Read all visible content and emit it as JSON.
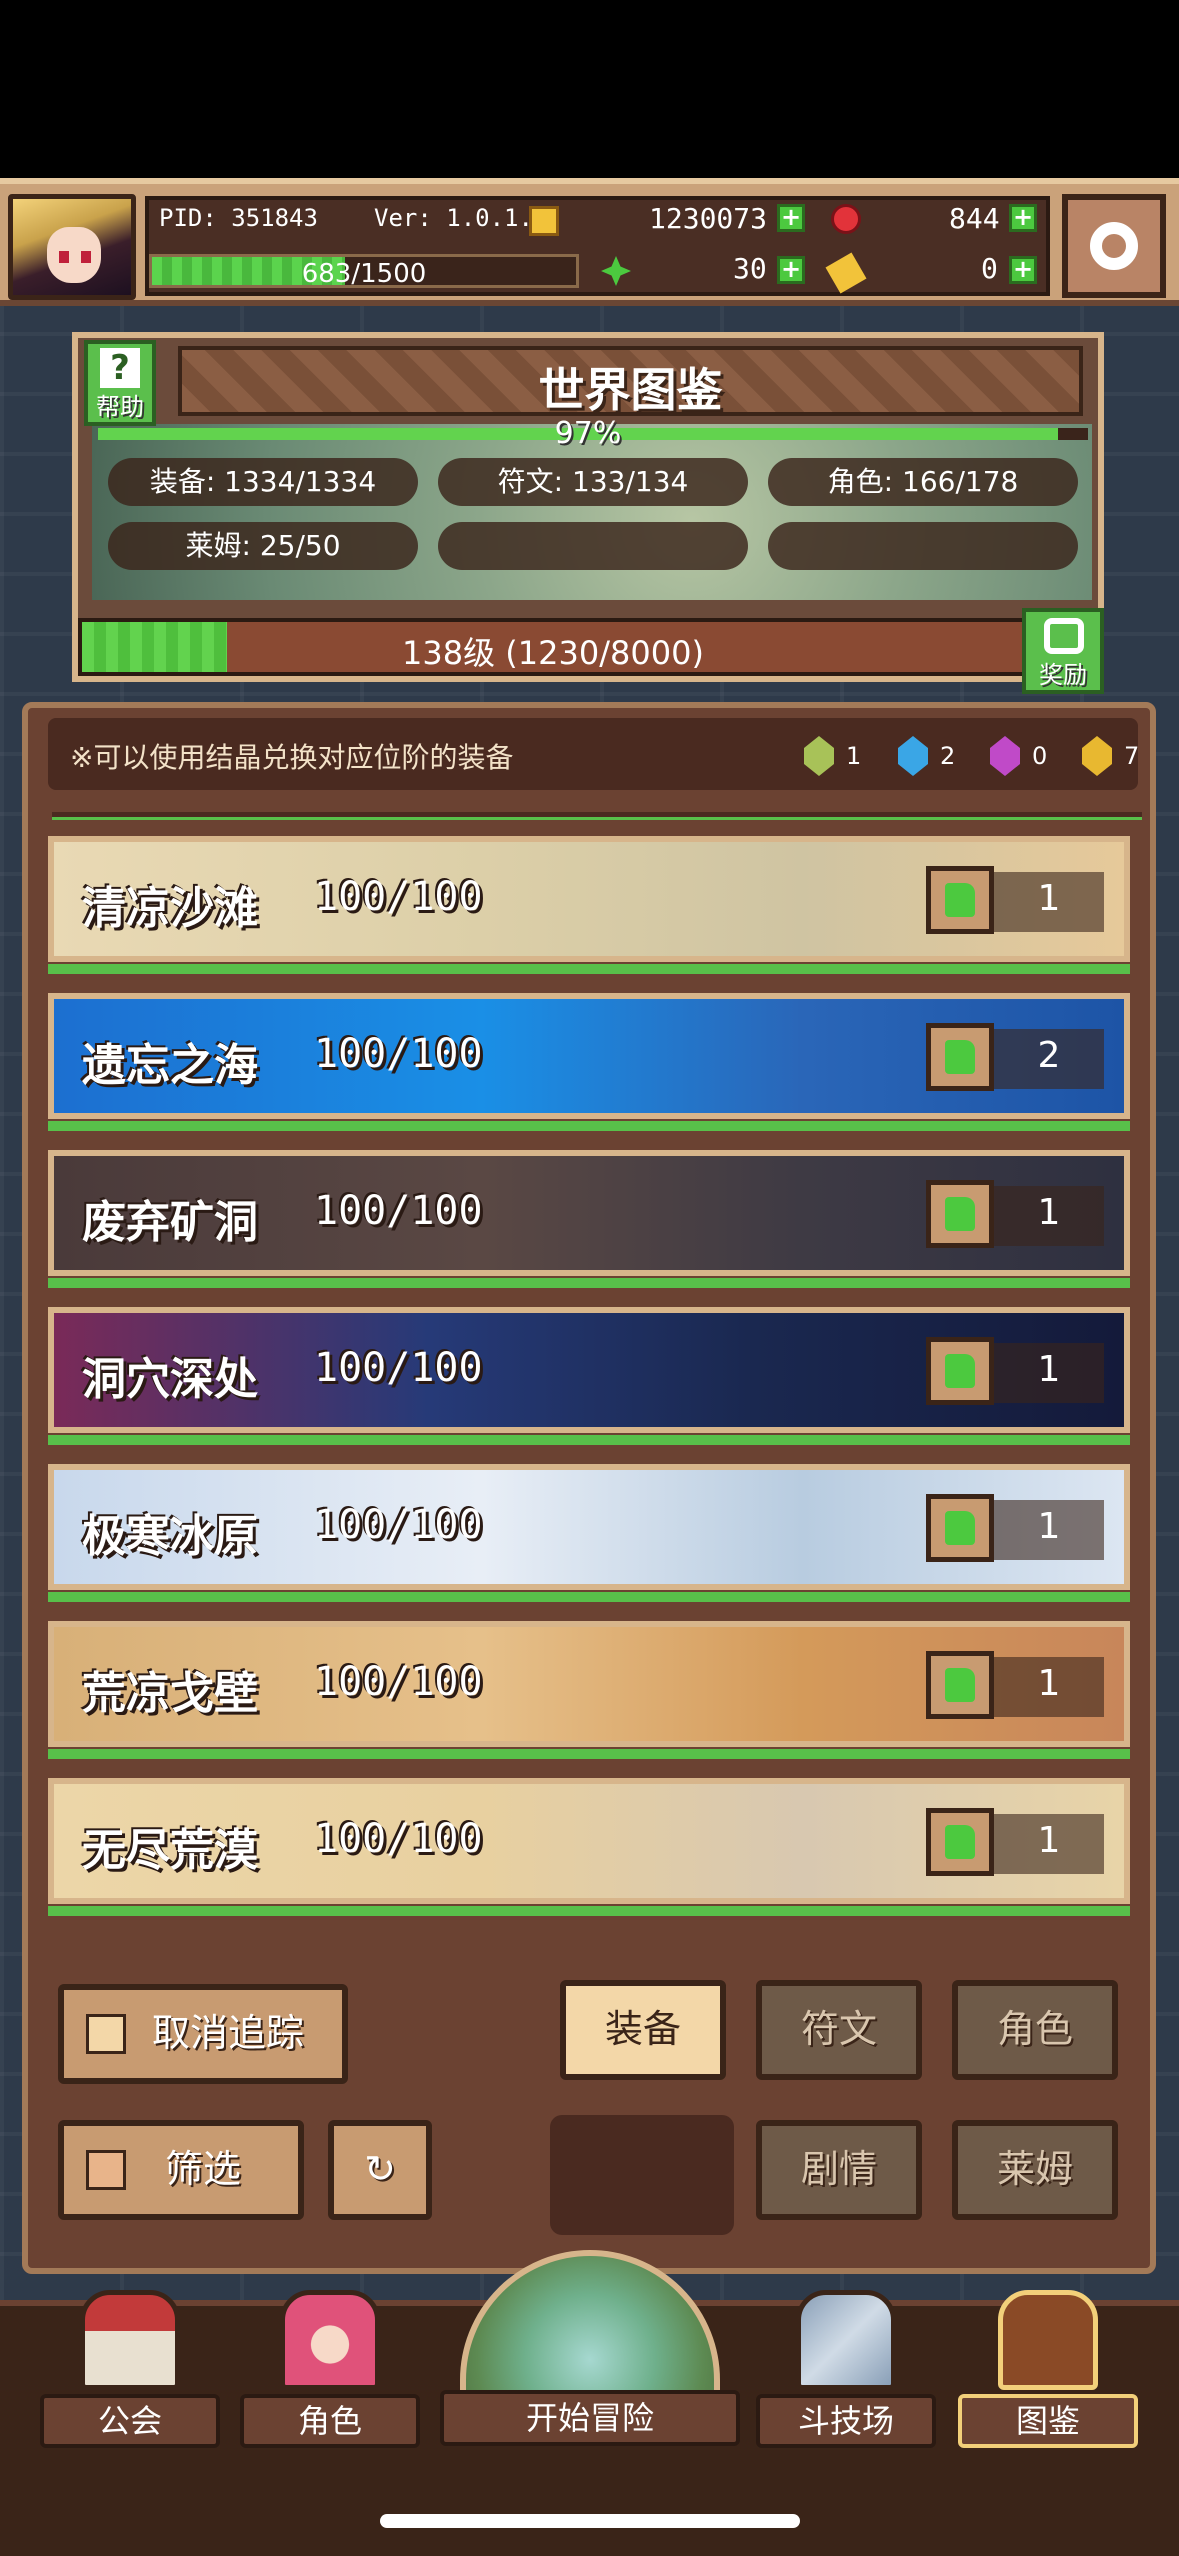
{
  "hud": {
    "pid": "PID: 351843",
    "version": "Ver: 1.0.1.4",
    "gold": "1230073",
    "gems": "844",
    "clover": "30",
    "keys": "0",
    "xp": "683/1500",
    "xp_fraction": 0.455
  },
  "header": {
    "title": "世界图鉴",
    "help_label": "帮助",
    "completion": "97%",
    "completion_fraction": 0.97,
    "stats": {
      "equipment": "装备: 1334/1334",
      "runes": "符文: 133/134",
      "characters": "角色: 166/178",
      "slime": "莱姆: 25/50"
    },
    "level_text": "138级 (1230/8000)",
    "level_fraction": 0.154,
    "reward_label": "奖励"
  },
  "notice": {
    "text": "※可以使用结晶兑换对应位阶的装备",
    "crystals": [
      {
        "color": "#a8c258",
        "count": "1"
      },
      {
        "color": "#3aa6e6",
        "count": "2"
      },
      {
        "color": "#c04ac8",
        "count": "0"
      },
      {
        "color": "#e8b830",
        "count": "7"
      }
    ]
  },
  "zones": [
    {
      "name": "清凉沙滩",
      "progress": "100/100",
      "likes": "1",
      "bg": "linear-gradient(90deg,#e9d9b4,#dccfa8 40%,#cfc4a2 70%,#e6c99a)"
    },
    {
      "name": "遗忘之海",
      "progress": "100/100",
      "likes": "2",
      "bg": "linear-gradient(90deg,#1c6fd0,#1a8fe6 40%,#2a66b8 70%,#1d54a6)"
    },
    {
      "name": "废弃矿洞",
      "progress": "100/100",
      "likes": "1",
      "bg": "linear-gradient(90deg,#4a3a3a,#5a4844 40%,#3e3a44 70%,#2e3040)"
    },
    {
      "name": "洞穴深处",
      "progress": "100/100",
      "likes": "1",
      "bg": "linear-gradient(90deg,#7a2a58,#263a78 35%,#1a2850 65%,#141a3a)"
    },
    {
      "name": "极寒冰原",
      "progress": "100/100",
      "likes": "1",
      "bg": "linear-gradient(90deg,#c8d8ec,#e8eef6 40%,#b8cce0 70%,#dce6f2)"
    },
    {
      "name": "荒凉戈壁",
      "progress": "100/100",
      "likes": "1",
      "bg": "linear-gradient(90deg,#d8b078,#e6c08a 40%,#d49a5a 70%,#c8865a)"
    },
    {
      "name": "无尽荒漠",
      "progress": "100/100",
      "likes": "1",
      "bg": "linear-gradient(90deg,#ecd6a8,#e8d0a0 40%,#d8c8b0 70%,#e8d4a8)"
    }
  ],
  "controls": {
    "untrack": "取消追踪",
    "filter": "筛选",
    "tab_equipment": "装备",
    "tab_runes": "符文",
    "tab_characters": "角色",
    "tab_story": "剧情",
    "tab_slime": "莱姆"
  },
  "nav": {
    "guild": "公会",
    "character": "角色",
    "start": "开始冒险",
    "arena": "斗技场",
    "codex": "图鉴"
  }
}
